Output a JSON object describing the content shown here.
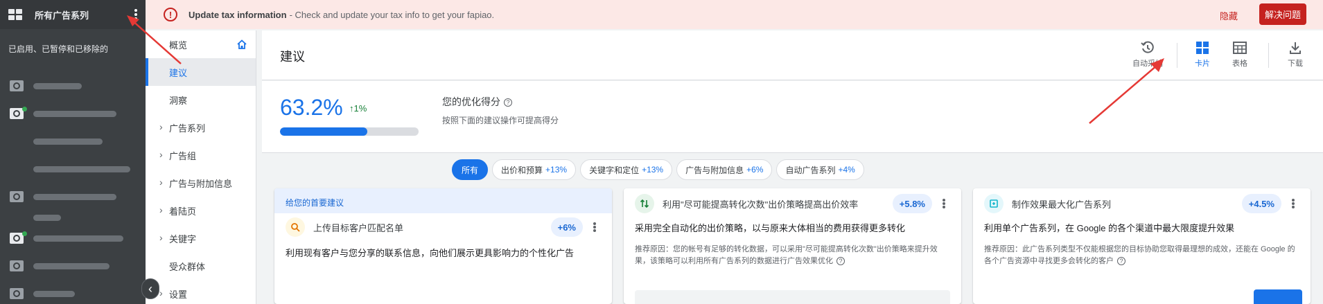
{
  "sidebar": {
    "title": "所有广告系列",
    "status_filter": "已启用、已暂停和已移除的"
  },
  "alert": {
    "title": "Update tax information",
    "detail": " - Check and update your tax info to get your fapiao.",
    "hide_label": "隐藏",
    "fix_label": "解决问题"
  },
  "nav": {
    "items": [
      {
        "label": "概览"
      },
      {
        "label": "建议"
      },
      {
        "label": "洞察"
      },
      {
        "label": "广告系列"
      },
      {
        "label": "广告组"
      },
      {
        "label": "广告与附加信息"
      },
      {
        "label": "着陆页"
      },
      {
        "label": "关键字"
      },
      {
        "label": "受众群体"
      },
      {
        "label": "设置"
      }
    ]
  },
  "header": {
    "title": "建议",
    "auto_apply_label": "自动采纳",
    "cards_label": "卡片",
    "table_label": "表格",
    "download_label": "下载"
  },
  "score": {
    "value": "63.2%",
    "delta": "↑1%",
    "progress_fraction": 0.632,
    "label": "您的优化得分",
    "help": "?",
    "sub": "按照下面的建议操作可提高得分"
  },
  "filters": {
    "all": "所有",
    "chips": [
      {
        "label": "出价和预算",
        "pct": "+13%"
      },
      {
        "label": "关键字和定位",
        "pct": "+13%"
      },
      {
        "label": "广告与附加信息",
        "pct": "+6%"
      },
      {
        "label": "自动广告系列",
        "pct": "+4%"
      }
    ]
  },
  "cards": {
    "c1": {
      "banner": "给您的首要建议",
      "title": "上传目标客户匹配名单",
      "badge": "+6%",
      "headline": "利用现有客户与您分享的联系信息，向他们展示更具影响力的个性化广告"
    },
    "c2": {
      "title": "利用\"尽可能提高转化次数\"出价策略提高出价效率",
      "badge": "+5.8%",
      "headline": "采用完全自动化的出价策略，以与原来大体相当的费用获得更多转化",
      "reason": "推荐原因：您的帐号有足够的转化数据，可以采用\"尽可能提高转化次数\"出价策略来提升效果，该策略可以利用所有广告系列的数据进行广告效果优化"
    },
    "c3": {
      "title": "制作效果最大化广告系列",
      "badge": "+4.5%",
      "headline": "利用单个广告系列，在 Google 的各个渠道中最大限度提升效果",
      "reason": "推荐原因：此广告系列类型不仅能根据您的目标协助您取得最理想的成效，还能在 Google 的各个广告资源中寻找更多会转化的客户"
    }
  },
  "colors": {
    "accent": "#1a73e8",
    "alert_bg": "#fce8e6",
    "alert_red": "#c5221f",
    "sidebar_bg": "#3c4043"
  }
}
